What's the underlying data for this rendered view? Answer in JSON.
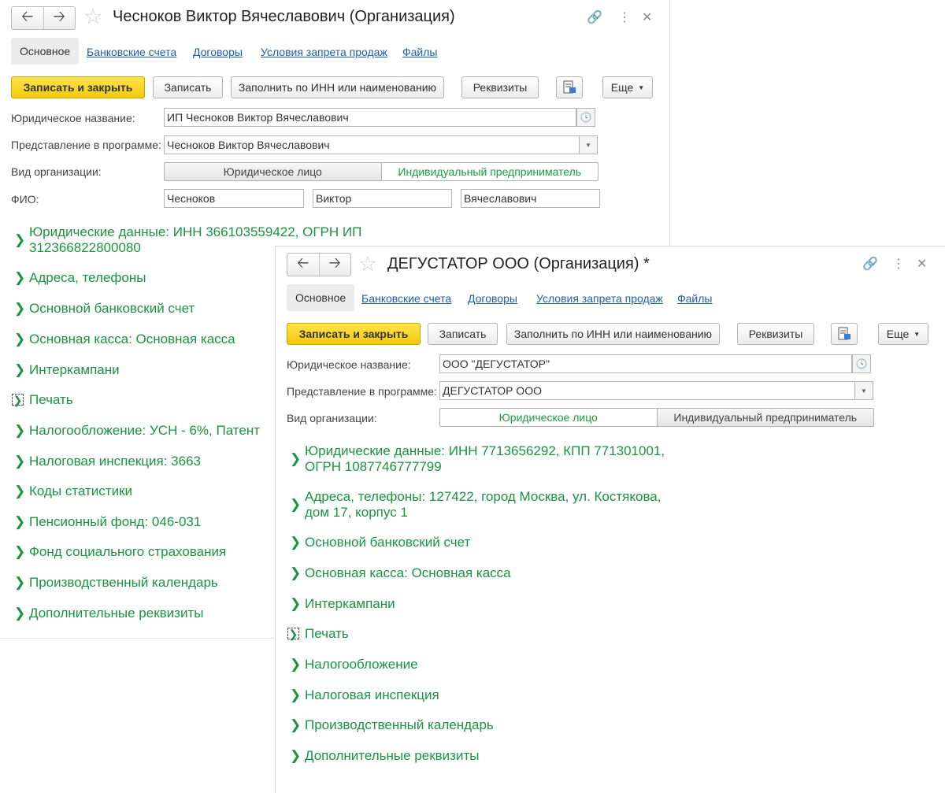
{
  "window1": {
    "title": "Чесноков Виктор Вячеславович (Организация)",
    "tabs": {
      "active": "Основное",
      "links": [
        "Банковские счета",
        "Договоры",
        "Условия запрета продаж",
        "Файлы"
      ]
    },
    "toolbar": {
      "save_close": "Записать и закрыть",
      "save": "Записать",
      "fill_inn": "Заполнить по ИНН или наименованию",
      "requisites": "Реквизиты",
      "more": "Еще"
    },
    "fields": {
      "legal_name_label": "Юридическое название:",
      "legal_name_value": "ИП Чесноков Виктор Вячеславович",
      "presentation_label": "Представление в программе:",
      "presentation_value": "Чесноков Виктор Вячеславович",
      "org_type_label": "Вид организации:",
      "org_type_options": [
        "Юридическое лицо",
        "Индивидуальный предприниматель"
      ],
      "fio_label": "ФИО:",
      "fio_values": [
        "Чесноков",
        "Виктор",
        "Вячеславович"
      ]
    },
    "groups": [
      "Юридические данные: ИНН 366103559422, ОГРН ИП 312366822800080",
      "Адреса, телефоны",
      "Основной банковский счет",
      "Основная касса: Основная касса",
      "Интеркампани",
      "Печать",
      "Налогообложение: УСН - 6%, Патент",
      "Налоговая инспекция: 3663",
      "Коды статистики",
      "Пенсионный фонд: 046-031",
      "Фонд социального страхования",
      "Производственный календарь",
      "Дополнительные реквизиты"
    ]
  },
  "window2": {
    "title": "ДЕГУСТАТОР ООО (Организация) *",
    "tabs": {
      "active": "Основное",
      "links": [
        "Банковские счета",
        "Договоры",
        "Условия запрета продаж",
        "Файлы"
      ]
    },
    "toolbar": {
      "save_close": "Записать и закрыть",
      "save": "Записать",
      "fill_inn": "Заполнить по ИНН или наименованию",
      "requisites": "Реквизиты",
      "more": "Еще"
    },
    "fields": {
      "legal_name_label": "Юридическое название:",
      "legal_name_value": "ООО \"ДЕГУСТАТОР\"",
      "presentation_label": "Представление в программе:",
      "presentation_value": "ДЕГУСТАТОР ООО",
      "org_type_label": "Вид организации:",
      "org_type_options": [
        "Юридическое лицо",
        "Индивидуальный предприниматель"
      ]
    },
    "groups": [
      "Юридические данные: ИНН 7713656292, КПП 771301001, ОГРН 1087746777799",
      "Адреса, телефоны: 127422, город Москва, ул. Костякова, дом 17, корпус 1",
      "Основной банковский счет",
      "Основная касса: Основная касса",
      "Интеркампани",
      "Печать",
      "Налогообложение",
      "Налоговая инспекция",
      "Производственный календарь",
      "Дополнительные реквизиты"
    ]
  }
}
